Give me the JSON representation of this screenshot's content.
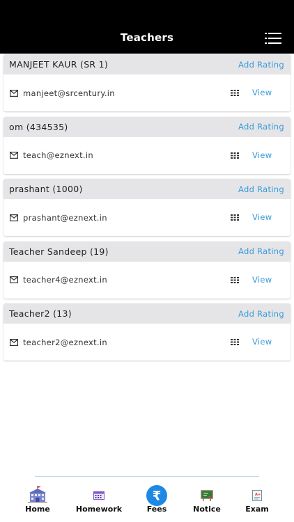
{
  "header": {
    "title": "Teachers",
    "menu_icon": "hamburger-menu-icon"
  },
  "teachers": [
    {
      "name": "MANJEET KAUR  (SR 1)",
      "add_rating": "Add Rating",
      "email": "manjeet@srcentury.in",
      "view": "View"
    },
    {
      "name": "om  (434535)",
      "add_rating": "Add Rating",
      "email": "teach@eznext.in",
      "view": "View"
    },
    {
      "name": "prashant  (1000)",
      "add_rating": "Add Rating",
      "email": "prashant@eznext.in",
      "view": "View"
    },
    {
      "name": "Teacher Sandeep  (19)",
      "add_rating": "Add Rating",
      "email": "teacher4@eznext.in",
      "view": "View"
    },
    {
      "name": "Teacher2  (13)",
      "add_rating": "Add Rating",
      "email": "teacher2@eznext.in",
      "view": "View"
    }
  ],
  "bottom_nav": [
    {
      "label": "Home",
      "icon": "school-building-icon"
    },
    {
      "label": "Homework",
      "icon": "homework-calendar-icon"
    },
    {
      "label": "Fees",
      "icon": "rupee-icon"
    },
    {
      "label": "Notice",
      "icon": "notice-board-icon"
    },
    {
      "label": "Exam",
      "icon": "exam-paper-icon"
    }
  ],
  "colors": {
    "accent": "#3a9ad9",
    "header_bg": "#000000",
    "card_head_bg": "#e5e5e8",
    "fees_icon": "#1e88e5"
  }
}
